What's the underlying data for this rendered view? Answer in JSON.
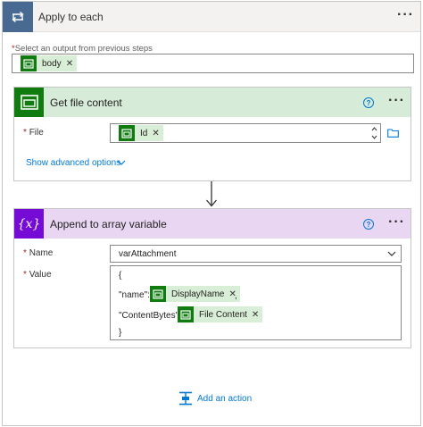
{
  "apply_to_each": {
    "title": "Apply to each",
    "select_label_required": "*",
    "select_label": "Select an output from previous steps",
    "body_token": "body"
  },
  "get_file_content": {
    "title": "Get file content",
    "file_label_required": "*",
    "file_label": "File",
    "file_token": "Id",
    "show_advanced": "Show advanced options"
  },
  "append_to_array": {
    "title": "Append to array variable",
    "name_label_required": "*",
    "name_label": "Name",
    "name_value": "varAttachment",
    "value_label_required": "*",
    "value_label": "Value",
    "value_lines": {
      "open_brace": "{",
      "name_key": "\"name\":",
      "name_token": "DisplayName",
      "comma": ",",
      "content_key": "\"ContentBytes\":",
      "content_token": "File Content",
      "close_brace": "}"
    }
  },
  "add_action": "Add an action",
  "colors": {
    "loop_header": "#486991",
    "sharepoint_green": "#107c10",
    "get_file_header": "#d6ebd8",
    "variable_header": "#e8d6f3",
    "variable_icon": "#770bd6",
    "link_blue": "#0078d4"
  },
  "icons": [
    "loop-icon",
    "sharepoint-icon",
    "variable-icon",
    "help-icon",
    "more-options-icon",
    "chevron-down-icon",
    "folder-icon",
    "arrow-down-icon",
    "add-action-icon"
  ]
}
